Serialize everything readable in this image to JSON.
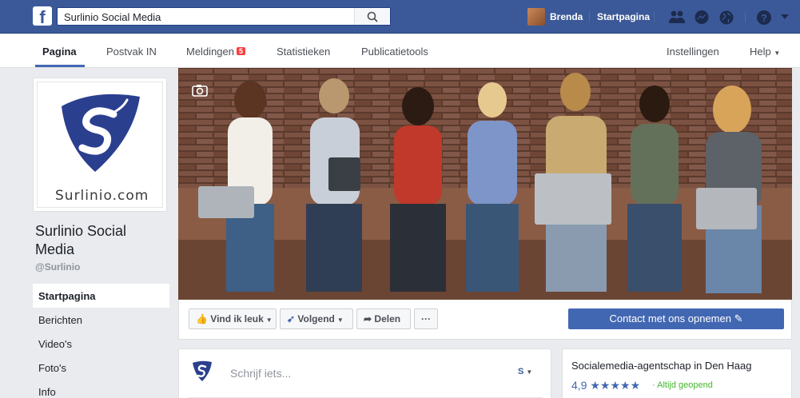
{
  "topbar": {
    "logo_letter": "f",
    "search_value": "Surlinio Social Media",
    "user_name": "Brenda",
    "home_label": "Startpagina"
  },
  "nav": {
    "tabs": [
      {
        "label": "Pagina",
        "active": true
      },
      {
        "label": "Postvak IN"
      },
      {
        "label": "Meldingen",
        "badge": "5"
      },
      {
        "label": "Statistieken"
      },
      {
        "label": "Publicatietools"
      }
    ],
    "settings": "Instellingen",
    "help": "Help"
  },
  "page": {
    "logo_text": "Surlinio.com",
    "name": "Surlinio Social Media",
    "handle": "@Surlinio"
  },
  "sidebar": {
    "items": [
      {
        "label": "Startpagina",
        "active": true
      },
      {
        "label": "Berichten"
      },
      {
        "label": "Video's"
      },
      {
        "label": "Foto's"
      },
      {
        "label": "Info"
      }
    ]
  },
  "actions": {
    "like": "Vind ik leuk",
    "follow": "Volgend",
    "share": "Delen",
    "more": "···",
    "contact": "Contact met ons opnemen"
  },
  "composer": {
    "placeholder": "Schrijf iets..."
  },
  "info": {
    "category": "Socialemedia-agentschap in Den Haag",
    "rating": "4,9",
    "stars": "★★★★★",
    "open_status": "Altijd geopend"
  },
  "colors": {
    "brand": "#3b5998",
    "accent": "#4267b2",
    "badge": "#fa3e3e",
    "open": "#42b72a"
  }
}
